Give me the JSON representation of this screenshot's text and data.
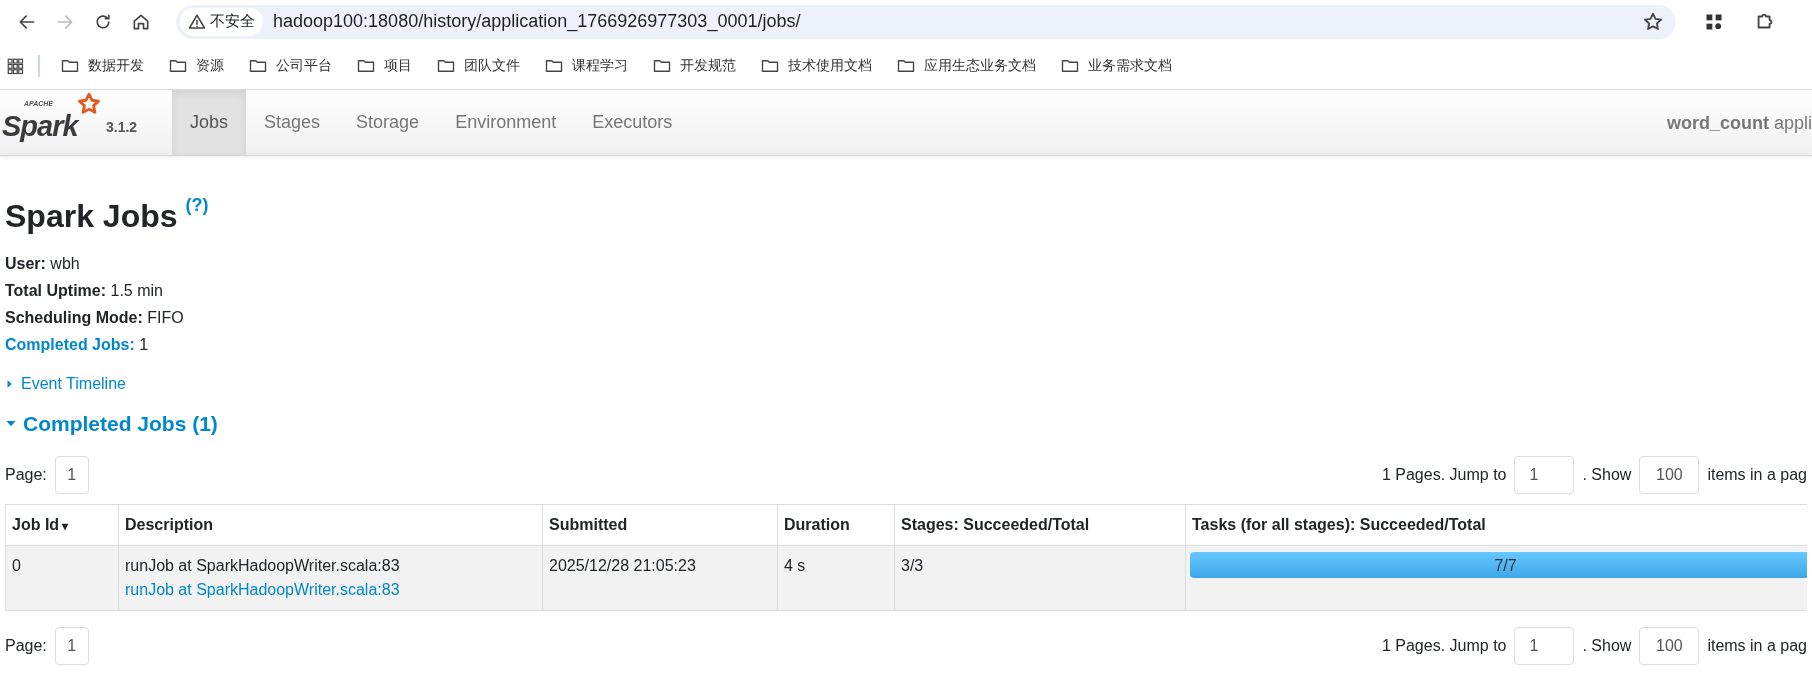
{
  "browser": {
    "back_enabled": true,
    "forward_enabled": false,
    "security_label": "不安全",
    "url": "hadoop100:18080/history/application_1766926977303_0001/jobs/"
  },
  "bookmarks": [
    {
      "label": "数据开发"
    },
    {
      "label": "资源"
    },
    {
      "label": "公司平台"
    },
    {
      "label": "项目"
    },
    {
      "label": "团队文件"
    },
    {
      "label": "课程学习"
    },
    {
      "label": "开发规范"
    },
    {
      "label": "技术使用文档"
    },
    {
      "label": "应用生态业务文档"
    },
    {
      "label": "业务需求文档"
    }
  ],
  "navbar": {
    "logo_small": "APACHE",
    "logo": "Spark",
    "version": "3.1.2",
    "tabs": [
      {
        "label": "Jobs",
        "selected": true
      },
      {
        "label": "Stages",
        "selected": false
      },
      {
        "label": "Storage",
        "selected": false
      },
      {
        "label": "Environment",
        "selected": false
      },
      {
        "label": "Executors",
        "selected": false
      }
    ],
    "app_name": "word_count",
    "app_suffix": "appli"
  },
  "page": {
    "title": "Spark Jobs",
    "help": "(?)",
    "summary": [
      {
        "label": "User:",
        "value": "wbh",
        "link": false
      },
      {
        "label": "Total Uptime:",
        "value": "1.5 min",
        "link": false
      },
      {
        "label": "Scheduling Mode:",
        "value": "FIFO",
        "link": false
      },
      {
        "label": "Completed Jobs:",
        "value": "1",
        "link": true
      }
    ],
    "event_timeline": {
      "label": "Event Timeline",
      "expanded": false
    },
    "section": {
      "label": "Completed Jobs (1)",
      "expanded": true
    }
  },
  "pagination": [
    {
      "page_label": "Page:",
      "page": "1",
      "pages_text": "1 Pages. Jump to",
      "jump": "1",
      "show_text": ". Show",
      "size": "100",
      "suffix": "items in a pag"
    },
    {
      "page_label": "Page:",
      "page": "1",
      "pages_text": "1 Pages. Jump to",
      "jump": "1",
      "show_text": ". Show",
      "size": "100",
      "suffix": "items in a pag"
    }
  ],
  "table": {
    "columns": [
      {
        "label": "Job Id",
        "sort_mark": "▾"
      },
      {
        "label": "Description"
      },
      {
        "label": "Submitted"
      },
      {
        "label": "Duration"
      },
      {
        "label": "Stages: Succeeded/Total"
      },
      {
        "label": "Tasks (for all stages): Succeeded/Total"
      }
    ],
    "rows": [
      {
        "job_id": "0",
        "description": "runJob at SparkHadoopWriter.scala:83",
        "description_link": "runJob at SparkHadoopWriter.scala:83",
        "submitted": "2025/12/28 21:05:23",
        "duration": "4 s",
        "stages": "3/3",
        "tasks": {
          "level": 1,
          "text": "7/7"
        }
      }
    ]
  }
}
